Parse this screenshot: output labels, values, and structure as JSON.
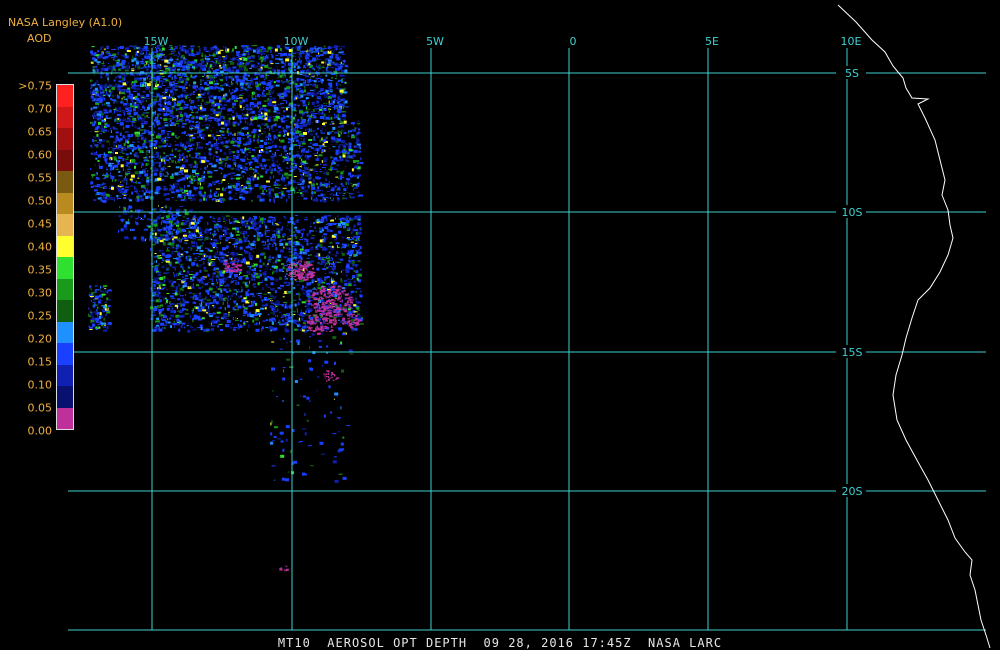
{
  "header": {
    "title": "NASA Langley (A1.0)",
    "subtitle": "AOD"
  },
  "legend": {
    "labels": [
      ">0.75",
      "0.70",
      "0.65",
      "0.60",
      "0.55",
      "0.50",
      "0.45",
      "0.40",
      "0.35",
      "0.30",
      "0.25",
      "0.20",
      "0.15",
      "0.10",
      "0.05",
      "0.00"
    ],
    "colors": [
      "#ff2020",
      "#d01818",
      "#a01010",
      "#7a0c0c",
      "#7a5a10",
      "#b88a20",
      "#e6b450",
      "#ffff30",
      "#30e030",
      "#1a9a1a",
      "#105e10",
      "#1e90ff",
      "#1a40ff",
      "#1020b0",
      "#081070",
      "#c0309a"
    ]
  },
  "map": {
    "longitude_labels": [
      "15W",
      "10W",
      "5W",
      "0",
      "5E",
      "10E"
    ],
    "latitude_labels": [
      "5S",
      "10S",
      "15S",
      "20S"
    ],
    "grid_color": "#40d0d0",
    "coast_color": "#ffffff",
    "background": "#000000"
  },
  "caption": "MT10  AEROSOL OPT DEPTH  09 28, 2016 17:45Z  NASA LARC"
}
